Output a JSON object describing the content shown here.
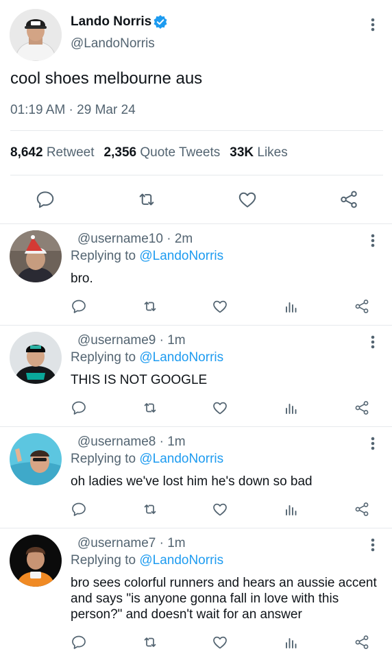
{
  "tweet": {
    "author_name": "Lando Norris",
    "author_handle": "@LandoNorris",
    "verified": true,
    "text": "cool shoes melbourne aus",
    "timestamp": "01:19 AM · 29 Mar 24",
    "stats": {
      "retweets": "8,642",
      "retweets_label": "Retweet",
      "quotes": "2,356",
      "quotes_label": "Quote Tweets",
      "likes": "33K",
      "likes_label": "Likes"
    },
    "actions": [
      "reply-icon",
      "retweet-icon",
      "like-icon",
      "share-icon"
    ]
  },
  "replies": [
    {
      "handle": "@username10",
      "time": "2m",
      "replying_label": "Replying to",
      "replying_to": "@LandoNorris",
      "text": "bro."
    },
    {
      "handle": "@username9",
      "time": "1m",
      "replying_label": "Replying to",
      "replying_to": "@LandoNorris",
      "text": "THIS IS NOT GOOGLE"
    },
    {
      "handle": "@username8",
      "time": "1m",
      "replying_label": "Replying to",
      "replying_to": "@LandoNorris",
      "text": "oh ladies we've lost him he's down so bad"
    },
    {
      "handle": "@username7",
      "time": "1m",
      "replying_label": "Replying to",
      "replying_to": "@LandoNorris",
      "text": "bro sees colorful runners and hears an aussie accent and says \"is anyone gonna fall in love with this person?\" and doesn't wait for an answer"
    }
  ],
  "colors": {
    "text_primary": "#0f1419",
    "text_secondary": "#536471",
    "link": "#1d9bf0",
    "verified": "#1d9bf0",
    "divider": "#e6e9ec"
  }
}
